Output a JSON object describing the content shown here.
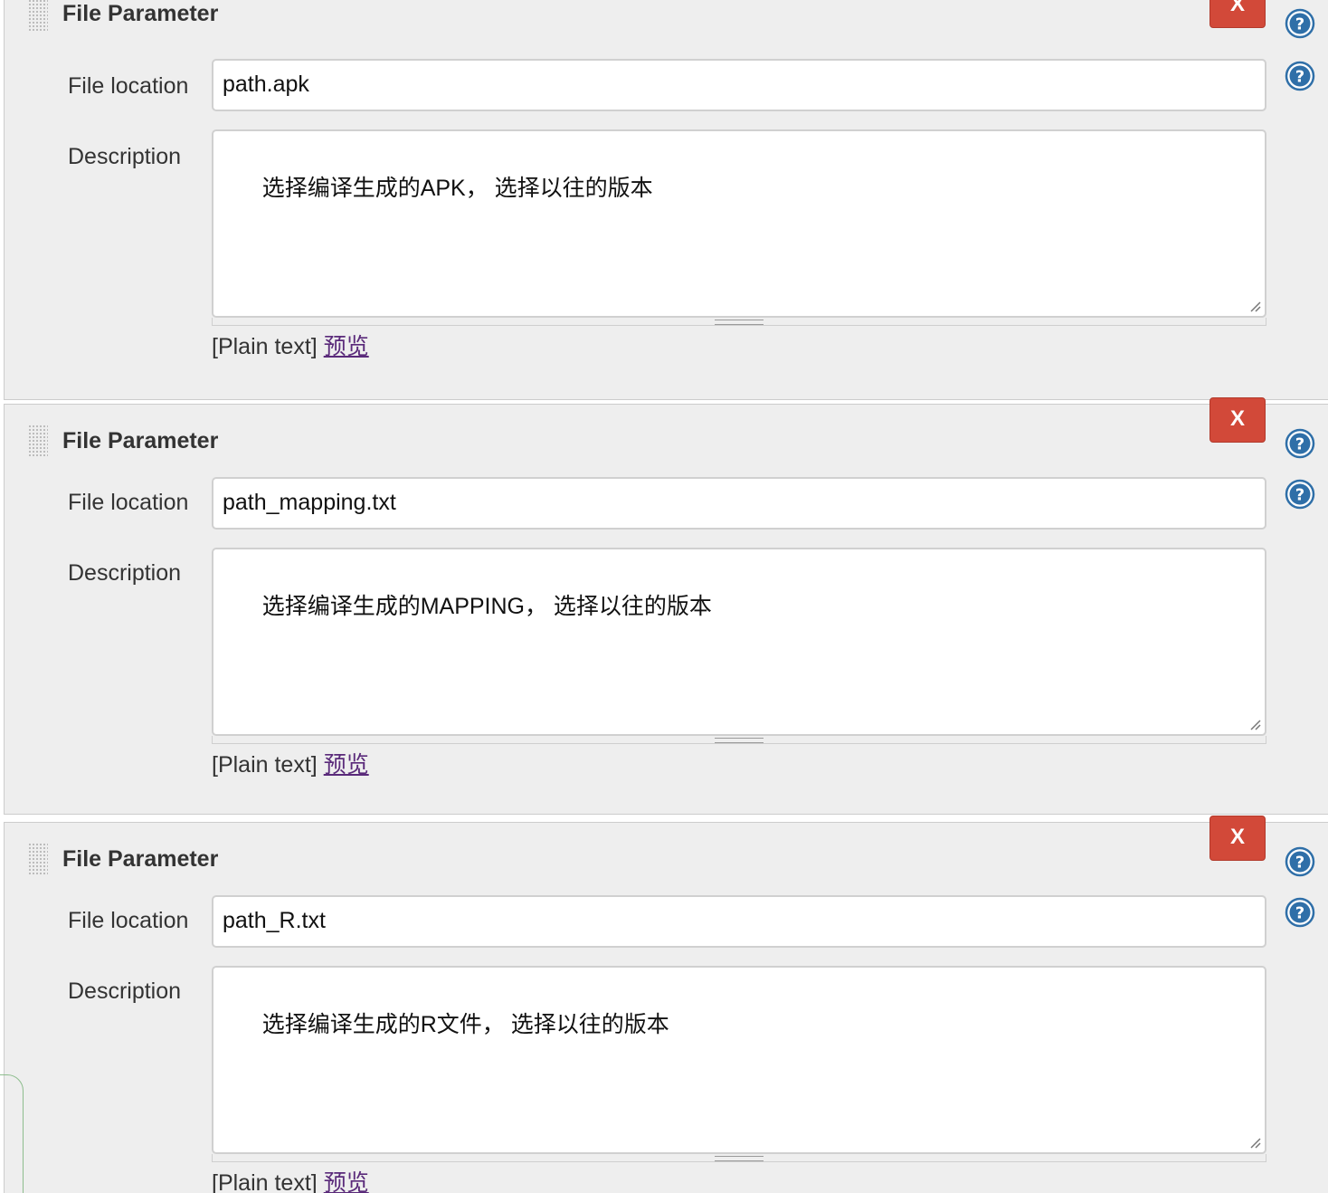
{
  "params": [
    {
      "title": "File Parameter",
      "delete_label": "X",
      "file_location_label": "File location",
      "file_location_value": "path.apk",
      "description_label": "Description",
      "description_value": "选择编译生成的APK， 选择以往的版本",
      "format_label": "[Plain text]",
      "preview_label": "预览"
    },
    {
      "title": "File Parameter",
      "delete_label": "X",
      "file_location_label": "File location",
      "file_location_value": "path_mapping.txt",
      "description_label": "Description",
      "description_value": "选择编译生成的MAPPING， 选择以往的版本",
      "format_label": "[Plain text]",
      "preview_label": "预览"
    },
    {
      "title": "File Parameter",
      "delete_label": "X",
      "file_location_label": "File location",
      "file_location_value": "path_R.txt",
      "description_label": "Description",
      "description_value": "选择编译生成的R文件， 选择以往的版本",
      "format_label": "[Plain text]",
      "preview_label": "预览"
    }
  ],
  "colors": {
    "delete_button": "#d24939",
    "help_icon": "#2f6fa8",
    "panel_background": "#eeeeee",
    "preview_link": "#5a2a7a"
  },
  "icons": {
    "help": "question-circle-icon",
    "drag": "drag-handle-icon",
    "resize": "resize-grip-icon"
  }
}
